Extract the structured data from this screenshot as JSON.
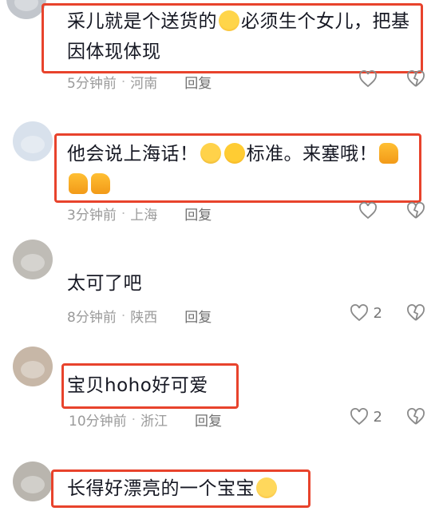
{
  "comments": [
    {
      "avatar": "user-avatar",
      "text_line1": "采儿就是个送货的",
      "text_line1_suffix": "必须生个女儿，把基",
      "text_line2": "因体现体现",
      "time": "5分钟前",
      "location": "河南",
      "reply": "回复",
      "likes": ""
    },
    {
      "avatar": "user-avatar",
      "text_line1_prefix": "他会说上海话！",
      "text_line1_mid": "标准。来塞哦！",
      "time": "3分钟前",
      "location": "上海",
      "reply": "回复",
      "likes": ""
    },
    {
      "avatar": "user-avatar",
      "text": "太可了吧",
      "time": "8分钟前",
      "location": "陕西",
      "reply": "回复",
      "likes": "2"
    },
    {
      "avatar": "user-avatar",
      "text": "宝贝hoho好可爱",
      "time": "10分钟前",
      "location": "浙江",
      "reply": "回复",
      "likes": "2"
    },
    {
      "avatar": "user-avatar",
      "text": "长得好漂亮的一个宝宝",
      "time": "",
      "location": "",
      "reply": "",
      "likes": ""
    }
  ],
  "colors": {
    "highlight": "#e8432c",
    "meta": "#9a9a9a",
    "text": "#161823"
  },
  "icons": [
    "heart-outline-icon",
    "broken-heart-icon",
    "laughing-emoji-icon",
    "thinking-emoji-icon",
    "smirk-emoji-icon",
    "thumbs-up-emoji-icon",
    "pleading-emoji-icon"
  ]
}
